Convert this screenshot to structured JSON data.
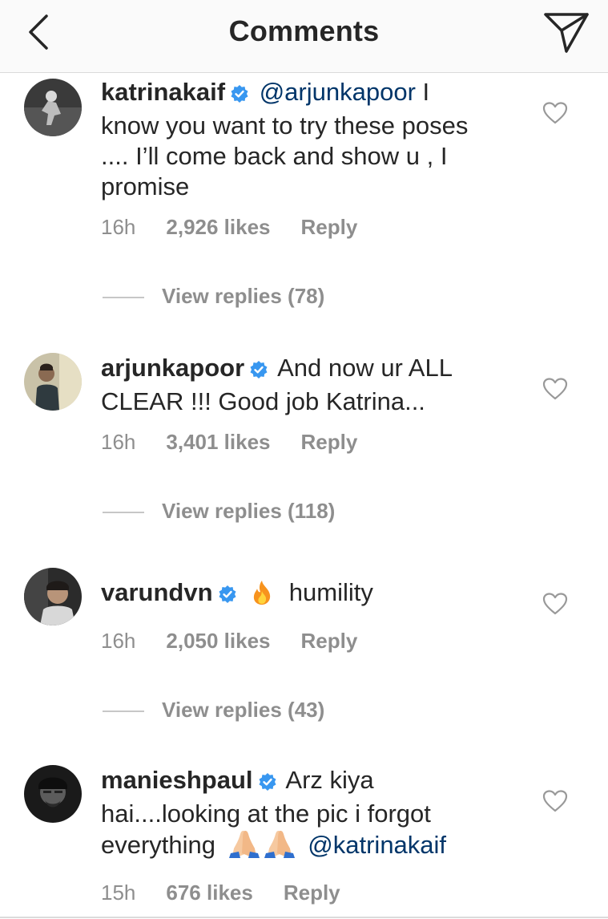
{
  "header": {
    "title": "Comments",
    "back_icon": "chevron-left-icon",
    "share_icon": "paper-plane-icon"
  },
  "colors": {
    "text": "#262626",
    "muted": "#8e8e8e",
    "mention": "#003569",
    "verified": "#3897f0"
  },
  "comments": [
    {
      "username": "katrinakaif",
      "verified": true,
      "mention": "@arjunkapoor",
      "text": "I know you want to try these poses .... I’ll come back and show u , I promise",
      "time": "16h",
      "likes": "2,926 likes",
      "reply": "Reply",
      "view_replies": "View replies (78)"
    },
    {
      "username": "arjunkapoor",
      "verified": true,
      "text": "And now ur ALL CLEAR !!! Good job Katrina...",
      "time": "16h",
      "likes": "3,401 likes",
      "reply": "Reply",
      "view_replies": "View replies (118)"
    },
    {
      "username": "varundvn",
      "verified": true,
      "emoji": "fire-emoji",
      "text": "humility",
      "time": "16h",
      "likes": "2,050 likes",
      "reply": "Reply",
      "view_replies": "View replies (43)"
    },
    {
      "username": "manieshpaul",
      "verified": true,
      "text": "Arz kiya hai....looking at the pic i forgot everything",
      "emoji": "folded-hands-emoji",
      "mention": "@katrinakaif",
      "time": "15h",
      "likes": "676 likes",
      "reply": "Reply"
    }
  ]
}
